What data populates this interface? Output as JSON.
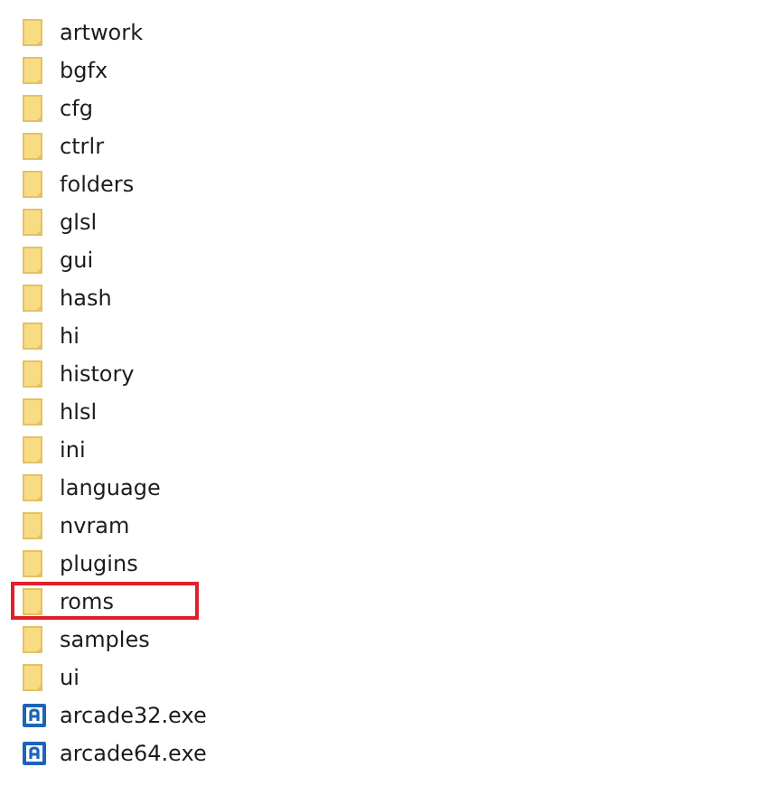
{
  "files": [
    {
      "name": "artwork",
      "kind": "folder",
      "highlighted": false
    },
    {
      "name": "bgfx",
      "kind": "folder",
      "highlighted": false
    },
    {
      "name": "cfg",
      "kind": "folder",
      "highlighted": false
    },
    {
      "name": "ctrlr",
      "kind": "folder",
      "highlighted": false
    },
    {
      "name": "folders",
      "kind": "folder",
      "highlighted": false
    },
    {
      "name": "glsl",
      "kind": "folder",
      "highlighted": false
    },
    {
      "name": "gui",
      "kind": "folder",
      "highlighted": false
    },
    {
      "name": "hash",
      "kind": "folder",
      "highlighted": false
    },
    {
      "name": "hi",
      "kind": "folder",
      "highlighted": false
    },
    {
      "name": "history",
      "kind": "folder",
      "highlighted": false
    },
    {
      "name": "hlsl",
      "kind": "folder",
      "highlighted": false
    },
    {
      "name": "ini",
      "kind": "folder",
      "highlighted": false
    },
    {
      "name": "language",
      "kind": "folder",
      "highlighted": false
    },
    {
      "name": "nvram",
      "kind": "folder",
      "highlighted": false
    },
    {
      "name": "plugins",
      "kind": "folder",
      "highlighted": false
    },
    {
      "name": "roms",
      "kind": "folder",
      "highlighted": true
    },
    {
      "name": "samples",
      "kind": "folder",
      "highlighted": false
    },
    {
      "name": "ui",
      "kind": "folder",
      "highlighted": false
    },
    {
      "name": "arcade32.exe",
      "kind": "exe",
      "highlighted": false
    },
    {
      "name": "arcade64.exe",
      "kind": "exe",
      "highlighted": false
    }
  ]
}
